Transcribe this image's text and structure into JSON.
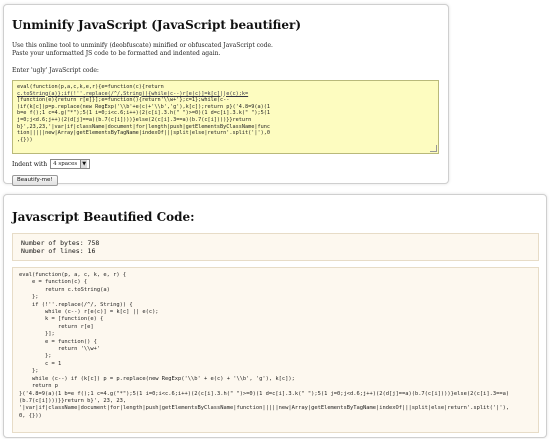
{
  "top": {
    "title": "Unminify JavaScript (JavaScript beautifier)",
    "desc1": "Use this online tool to unminify (deobfuscate) minified or obfuscated JavaScript code.",
    "desc2": "Paste your unformatted JS code to be formatted and indented again.",
    "input_label": "Enter 'ugly' JavaScript code:",
    "code_lines": [
      "eval(function(p,a,c,k,e,r){e=function(c){return",
      "c.toString(a)};if(!''.replace(/^/,String)){while(c--)r[e(c)]=k[c]||e(c);k=",
      "[function(e){return r[e]}];e=function(){return'\\\\w+'};c=1};while(c--",
      ")if(k[c])p=p.replace(new RegExp('\\\\b'+e(c)+'\\\\b','g'),k[c]);return p}('4.8=9(a)(1",
      "b=e f();1 c=4.g(\"*\");5(1 i=0;i<c.6;i++)(2(c[i].3.h(\" \")>=0)(1 d=c[i].3.k(\" \");5(1",
      "j=0;j<d.6;j++)(2(d[j]==a)(b.7(c[i])))}else(2(c[i].3==a)(b.7(c[i])))}}return",
      "b}',23,23,'|var|if|className|document|for|length|push|getElementsByClassName|func",
      "tion|||||new|Array|getElementsByTagName|indexOf|||split|else|return'.split('|'),0",
      ",{}))"
    ],
    "indent_label": "Indent with",
    "indent_value": "4 spaces",
    "button_label": "Beautify-me!"
  },
  "bottom": {
    "title": "Javascript Beautified Code:",
    "bytes": "Number of bytes: 758",
    "lines": "Number of lines: 16",
    "output_lines": [
      "eval(function(p, a, c, k, e, r) {",
      "    e = function(c) {",
      "        return c.toString(a)",
      "    };",
      "    if (!''.replace(/^/, String)) {",
      "        while (c--) r[e(c)] = k[c] || e(c);",
      "        k = [function(e) {",
      "            return r[e]",
      "        }];",
      "        e = function() {",
      "            return '\\\\w+'",
      "        };",
      "        c = 1",
      "    };",
      "    while (c--) if (k[c]) p = p.replace(new RegExp('\\\\b' + e(c) + '\\\\b', 'g'), k[c]);",
      "    return p",
      "}('4.8=9(a)(1 b=e f();1 c=4.g(\"*\");5(1 i=0;i<c.6;i++)(2(c[i].3.h(\" \")>=0)(1 d=c[i].3.k(\" \");5(1 j=0;j<d.6;j++)(2(d[j]==a)(b.7(c[i])))}else(2(c[i].3==a)",
      "(b.7(c[i])))}}return b}', 23, 23,",
      "'|var|if|className|document|for|length|push|getElementsByClassName|function|||||new|Array|getElementsByTagName|indexOf|||split|else|return'.split('|'),",
      "0, {}))"
    ]
  }
}
